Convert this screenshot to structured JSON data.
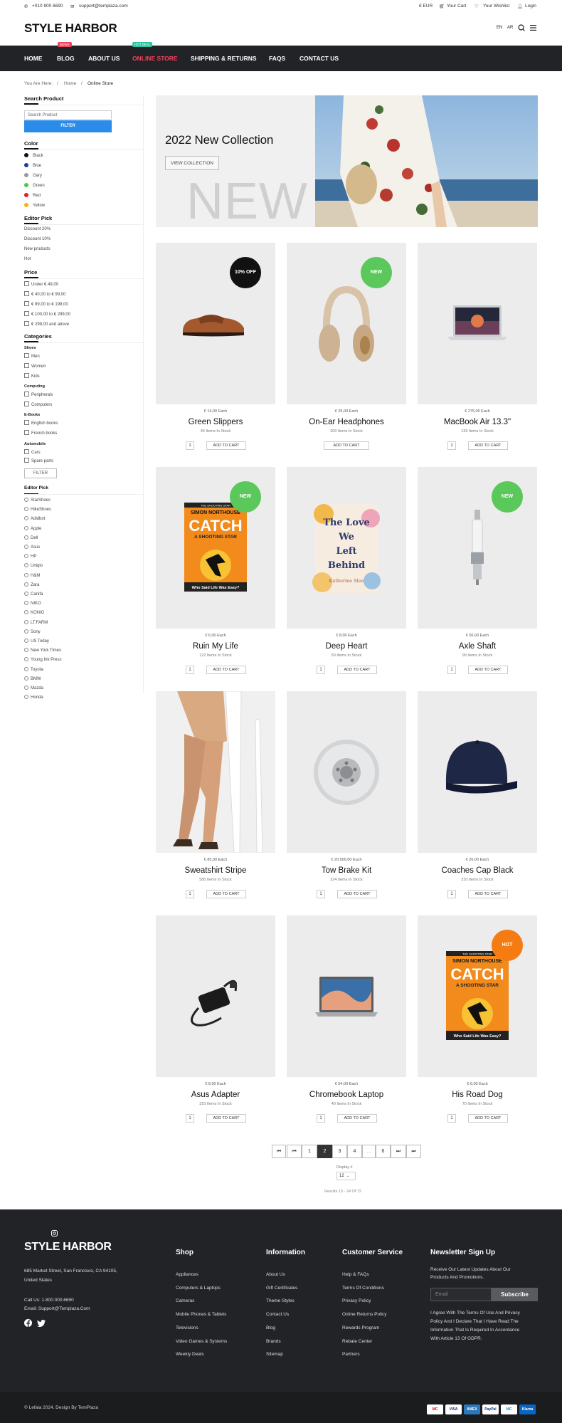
{
  "topbar": {
    "phone": "+010 900 6690",
    "email": "support@templaza.com",
    "currency": "€ EUR",
    "cart": "Your Cart",
    "wishlist": "Your Wishlist",
    "login": "Login"
  },
  "header": {
    "logo": "STYLE HARBOR",
    "lang1": "EN",
    "lang2": "AR"
  },
  "nav": {
    "items": [
      "HOME",
      "BLOG",
      "ABOUT US",
      "ONLINE STORE",
      "SHIPPING & RETURNS",
      "FAQS",
      "CONTACT US"
    ],
    "badge_blog": "NEWS",
    "badge_store": "HOT DEAL",
    "active_color": "#f2435f"
  },
  "breadcrumb": {
    "prefix": "You Are Here:",
    "home": "Home",
    "current": "Online Store"
  },
  "sidebar": {
    "search_title": "Search Product",
    "search_placeholder": "Search Product",
    "filter_label": "FILTER",
    "color_title": "Color",
    "colors": [
      {
        "name": "Black",
        "hex": "#111"
      },
      {
        "name": "Blue",
        "hex": "#1e3f99"
      },
      {
        "name": "Gary",
        "hex": "#999"
      },
      {
        "name": "Green",
        "hex": "#3fcf3f"
      },
      {
        "name": "Red",
        "hex": "#e02020"
      },
      {
        "name": "Yellow",
        "hex": "#f5b800"
      }
    ],
    "editor_title": "Editor Pick",
    "editor": [
      "Discount 20%",
      "Discount 10%",
      "New products",
      "Hot"
    ],
    "price_title": "Price",
    "prices": [
      "Under € 49,00",
      "€ 40,00 to € 99,00",
      "€ 99,00 to € 199,00",
      "€ 100,00 to € 299,00",
      "€ 299,00 and above"
    ],
    "cat_title": "Categories",
    "cat_shoes": "Shoes",
    "shoes": [
      "Men",
      "Women",
      "Kids"
    ],
    "cat_computing": "Computing",
    "computing": [
      "Peripherals",
      "Computers"
    ],
    "cat_ebooks": "E-Books",
    "ebooks": [
      "English books",
      "French books"
    ],
    "cat_auto": "Automobile",
    "auto": [
      "Cars",
      "Spare parts"
    ],
    "filter2": "FILTER",
    "brand_title": "Editor Pick",
    "brands": [
      "StarShoes",
      "HikeShoes",
      "Adidbot",
      "Apple",
      "Dell",
      "Asus",
      "HP",
      "Uniqlo",
      "H&M",
      "Zara",
      "Canifa",
      "NIKO",
      "KONIG",
      "LT.FARM",
      "Sony",
      "US Today",
      "New York Times",
      "Young Ink Press",
      "Toyota",
      "BMW",
      "Mazda",
      "Honda"
    ]
  },
  "hero": {
    "title": "2022 New Collection",
    "button": "VIEW COLLECTION",
    "bg_word": "NEW"
  },
  "products": [
    {
      "price": "€ 14,00 Each",
      "name": "Green Slippers",
      "stock": "45 Items In Stock",
      "tag": "10% OFF",
      "tag_color": "#111",
      "qty": "1",
      "btn": "ADD TO CART"
    },
    {
      "price": "€ 25,00 Each",
      "name": "On-Ear Headphones",
      "stock": "200 Items In Stock",
      "tag": "NEW",
      "tag_color": "#5ac85a",
      "qty": "",
      "btn": "ADD TO CART"
    },
    {
      "price": "€ 275,00 Each",
      "name": "MacBook Air 13.3\"",
      "stock": "136 Items In Stock",
      "tag": "",
      "tag_color": "",
      "qty": "1",
      "btn": "ADD TO CART"
    },
    {
      "price": "€ 6,00 Each",
      "name": "Ruin My Life",
      "stock": "122 Items In Stock",
      "tag": "NEW",
      "tag_color": "#5ac85a",
      "qty": "1",
      "btn": "ADD TO CART"
    },
    {
      "price": "€ 8,00 Each",
      "name": "Deep Heart",
      "stock": "50 Items In Stock",
      "tag": "",
      "tag_color": "",
      "qty": "1",
      "btn": "ADD TO CART"
    },
    {
      "price": "€ 56,00 Each",
      "name": "Axle Shaft",
      "stock": "99 Items In Stock",
      "tag": "NEW",
      "tag_color": "#5ac85a",
      "qty": "1",
      "btn": "ADD TO CART"
    },
    {
      "price": "€ 85,00 Each",
      "name": "Sweatshirt Stripe",
      "stock": "580 Items In Stock",
      "tag": "",
      "tag_color": "",
      "qty": "1",
      "btn": "ADD TO CART"
    },
    {
      "price": "€ 20.000,00 Each",
      "name": "Tow Brake Kit",
      "stock": "224 Items In Stock",
      "tag": "",
      "tag_color": "",
      "qty": "1",
      "btn": "ADD TO CART"
    },
    {
      "price": "€ 26,00 Each",
      "name": "Coaches Cap Black",
      "stock": "310 Items In Stock",
      "tag": "",
      "tag_color": "",
      "qty": "1",
      "btn": "ADD TO CART"
    },
    {
      "price": "€ 8,00 Each",
      "name": "Asus Adapter",
      "stock": "310 Items In Stock",
      "tag": "",
      "tag_color": "",
      "qty": "1",
      "btn": "ADD TO CART"
    },
    {
      "price": "€ 54,00 Each",
      "name": "Chromebook Laptop",
      "stock": "40 Items In Stock",
      "tag": "",
      "tag_color": "",
      "qty": "1",
      "btn": "ADD TO CART"
    },
    {
      "price": "€ 6,00 Each",
      "name": "His Road Dog",
      "stock": "70 Items In Stock",
      "tag": "HOT",
      "tag_color": "#f57c12",
      "qty": "1",
      "btn": "ADD TO CART"
    }
  ],
  "book1": {
    "top": "THE SHOOTING STAR",
    "author": "SIMON NORTHOUSE",
    "title": "CATCH",
    "sub": "A SHOOTING STAR",
    "bottom": "Who Said Life Was Easy?"
  },
  "book2": {
    "t1": "The Love",
    "t2": "We",
    "t3": "Left",
    "t4": "Behind",
    "author": "Katherine Slee"
  },
  "pagination": {
    "pages": [
      "1",
      "2",
      "3",
      "4",
      "...",
      "6"
    ],
    "first": "⏮",
    "prev": "⏮",
    "next": "⏭",
    "last": "⏭",
    "current": "2",
    "display_label": "Display #",
    "display_value": "12",
    "results": "Results 13 - 24 Of 72"
  },
  "footer": {
    "logo": "STYLE HARBOR",
    "address": "685 Market Street, San Francisco, CA 94105,",
    "address2": "United States",
    "call": "Call Us: 1.800.000.6690",
    "email": "Email: Support@Templaza.Com",
    "shop_title": "Shop",
    "shop": [
      "Appliances",
      "Computers & Laptops",
      "Cameras",
      "Mobile Phones & Tablets",
      "Televisions",
      "Video Games & Systems",
      "Weekly Deals"
    ],
    "info_title": "Information",
    "info": [
      "About Us",
      "Gift Certificates",
      "Theme Styles",
      "Contact Us",
      "Blog",
      "Brands",
      "Sitemap"
    ],
    "cs_title": "Customer Service",
    "cs": [
      "Help & FAQs",
      "Terms Of Conditions",
      "Privacy Policy",
      "Online Returns Policy",
      "Rewards Program",
      "Rebate Center",
      "Partners"
    ],
    "news_title": "Newsletter Sign Up",
    "news_text1": "Receive Our Latest Updates About Our",
    "news_text2": "Products And Promotions.",
    "email_placeholder": "Email",
    "subscribe": "Subscribe",
    "agree1": "I Agree With The Terms Of Use And Privacy",
    "agree2": "Policy And I Declare That I Have Read The",
    "agree3": "Information That Is Required In Accordance",
    "agree4": "With Article 13 Of GDPR.",
    "copyright": "© Lefala 2024. Design By TemPlaza",
    "payments": [
      "MC",
      "VISA",
      "AMEX",
      "PayPal",
      "MC",
      "Klarna"
    ]
  }
}
